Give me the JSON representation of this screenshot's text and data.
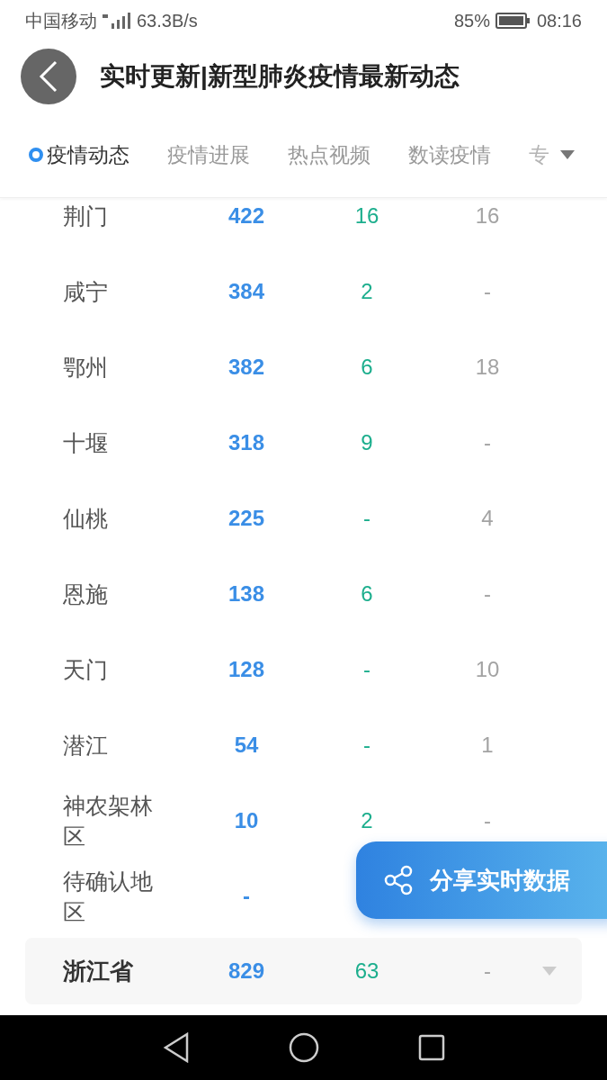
{
  "status_bar": {
    "carrier": "中国移动",
    "network_speed": "63.3B/s",
    "battery": "85%",
    "time": "08:16"
  },
  "header": {
    "title": "实时更新|新型肺炎疫情最新动态"
  },
  "tabs": [
    {
      "label": "疫情动态",
      "selected": true
    },
    {
      "label": "疫情进展",
      "selected": false
    },
    {
      "label": "热点视频",
      "selected": false
    },
    {
      "label": "数读疫情",
      "selected": false
    },
    {
      "label": "专",
      "selected": false
    }
  ],
  "table": {
    "rows": [
      {
        "name": "荆门",
        "values": [
          "422",
          "16",
          "16"
        ]
      },
      {
        "name": "咸宁",
        "values": [
          "384",
          "2",
          "-"
        ]
      },
      {
        "name": "鄂州",
        "values": [
          "382",
          "6",
          "18"
        ]
      },
      {
        "name": "十堰",
        "values": [
          "318",
          "9",
          "-"
        ]
      },
      {
        "name": "仙桃",
        "values": [
          "225",
          "-",
          "4"
        ]
      },
      {
        "name": "恩施",
        "values": [
          "138",
          "6",
          "-"
        ]
      },
      {
        "name": "天门",
        "values": [
          "128",
          "-",
          "10"
        ]
      },
      {
        "name": "潜江",
        "values": [
          "54",
          "-",
          "1"
        ]
      },
      {
        "name": "神农架林区",
        "values": [
          "10",
          "2",
          "-"
        ]
      },
      {
        "name": "待确认地区",
        "values": [
          "-"
        ]
      }
    ],
    "province": {
      "name": "浙江省",
      "values": [
        "829",
        "63",
        "-"
      ]
    }
  },
  "share_button": {
    "label": "分享实时数据"
  }
}
